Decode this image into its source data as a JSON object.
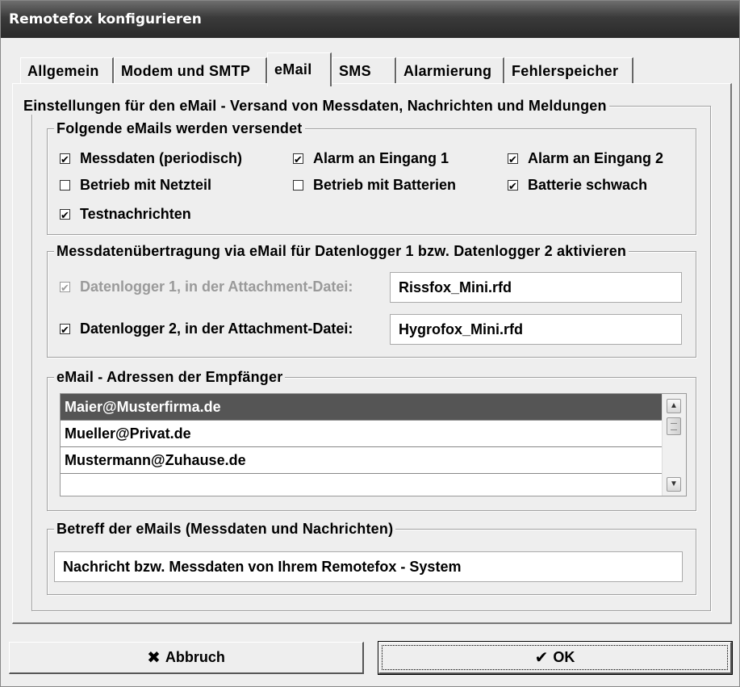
{
  "window": {
    "title": "Remotefox konfigurieren"
  },
  "tabs": [
    {
      "label": "Allgemein",
      "active": false
    },
    {
      "label": "Modem und SMTP",
      "active": false
    },
    {
      "label": "eMail",
      "active": true
    },
    {
      "label": "SMS",
      "active": false
    },
    {
      "label": "Alarmierung",
      "active": false
    },
    {
      "label": "Fehlerspeicher",
      "active": false
    }
  ],
  "main_group": {
    "legend": "Einstellungen für den eMail - Versand von Messdaten, Nachrichten und Meldungen"
  },
  "emails_group": {
    "legend": "Folgende eMails werden versendet",
    "options": [
      {
        "label": "Messdaten (periodisch)",
        "checked": true
      },
      {
        "label": "Alarm an Eingang 1",
        "checked": true
      },
      {
        "label": "Alarm an Eingang 2",
        "checked": true
      },
      {
        "label": "Betrieb mit Netzteil",
        "checked": false
      },
      {
        "label": "Betrieb mit Batterien",
        "checked": false
      },
      {
        "label": "Batterie schwach",
        "checked": true
      },
      {
        "label": "Testnachrichten",
        "checked": true
      }
    ]
  },
  "logger_group": {
    "legend": "Messdatenübertragung via eMail für Datenlogger 1 bzw. Datenlogger 2 aktivieren",
    "logger1": {
      "label": "Datenlogger 1, in der Attachment-Datei:",
      "checked": true,
      "enabled": false,
      "file": "Rissfox_Mini.rfd"
    },
    "logger2": {
      "label": "Datenlogger 2, in der Attachment-Datei:",
      "checked": true,
      "enabled": true,
      "file": "Hygrofox_Mini.rfd"
    }
  },
  "recipients_group": {
    "legend": "eMail - Adressen der Empfänger",
    "addresses": [
      "Maier@Musterfirma.de",
      "Mueller@Privat.de",
      "Mustermann@Zuhause.de",
      ""
    ],
    "selected_index": 0
  },
  "subject_group": {
    "legend": "Betreff der eMails (Messdaten und Nachrichten)",
    "value": "Nachricht bzw. Messdaten von Ihrem Remotefox - System"
  },
  "buttons": {
    "cancel": {
      "label": "Abbruch",
      "icon": "x-icon"
    },
    "ok": {
      "label": "OK",
      "icon": "checkmark-icon"
    }
  },
  "colors": {
    "selected_row": "#555555",
    "titlebar": "#3a3a3a",
    "dialog_bg": "#eeeeee"
  }
}
